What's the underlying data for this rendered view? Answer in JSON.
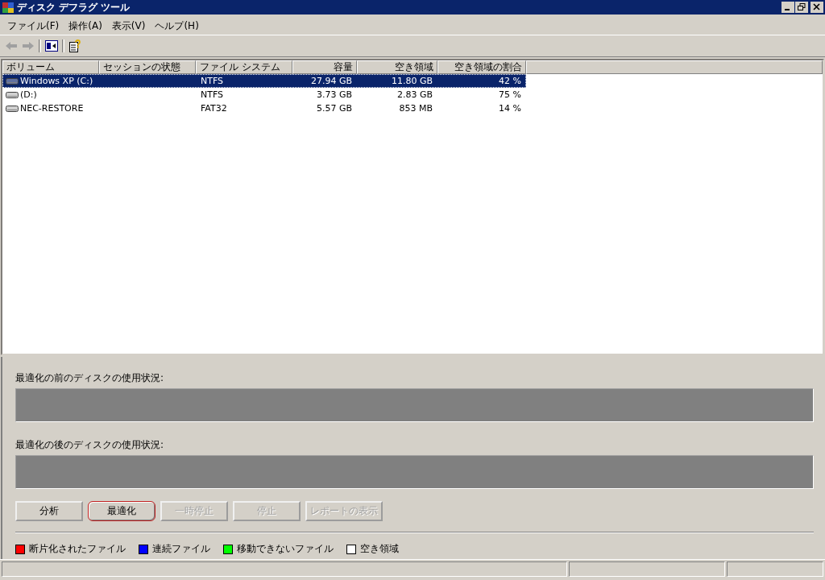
{
  "window": {
    "title": "ディスク デフラグ ツール"
  },
  "menu": [
    "ファイル(F)",
    "操作(A)",
    "表示(V)",
    "ヘルプ(H)"
  ],
  "table": {
    "columns": [
      {
        "label": "ボリューム"
      },
      {
        "label": "セッションの状態"
      },
      {
        "label": "ファイル システム"
      },
      {
        "label": "容量"
      },
      {
        "label": "空き領域"
      },
      {
        "label": "空き領域の割合"
      }
    ],
    "rows": [
      {
        "selected": true,
        "cells": [
          "Windows XP (C:)",
          "",
          "NTFS",
          "27.94 GB",
          "11.80 GB",
          "42 %"
        ]
      },
      {
        "selected": false,
        "cells": [
          "(D:)",
          "",
          "NTFS",
          "3.73 GB",
          "2.83 GB",
          "75 %"
        ]
      },
      {
        "selected": false,
        "cells": [
          "NEC-RESTORE",
          "",
          "FAT32",
          "5.57 GB",
          "853 MB",
          "14 %"
        ]
      }
    ]
  },
  "usage": [
    {
      "label": "最適化の前のディスクの使用状況:"
    },
    {
      "label": "最適化の後のディスクの使用状況:"
    }
  ],
  "buttons": [
    {
      "label": "分析",
      "disabled": false,
      "focused": false
    },
    {
      "label": "最適化",
      "disabled": false,
      "focused": true
    },
    {
      "label": "一時停止",
      "disabled": true,
      "focused": false
    },
    {
      "label": "停止",
      "disabled": true,
      "focused": false
    },
    {
      "label": "レポートの表示",
      "disabled": true,
      "focused": false
    }
  ],
  "legend": [
    {
      "label": "断片化されたファイル",
      "color": "#ff0000"
    },
    {
      "label": "連続ファイル",
      "color": "#0000ff"
    },
    {
      "label": "移動できないファイル",
      "color": "#00ff00"
    },
    {
      "label": "空き領域",
      "color": "#ffffff"
    }
  ]
}
